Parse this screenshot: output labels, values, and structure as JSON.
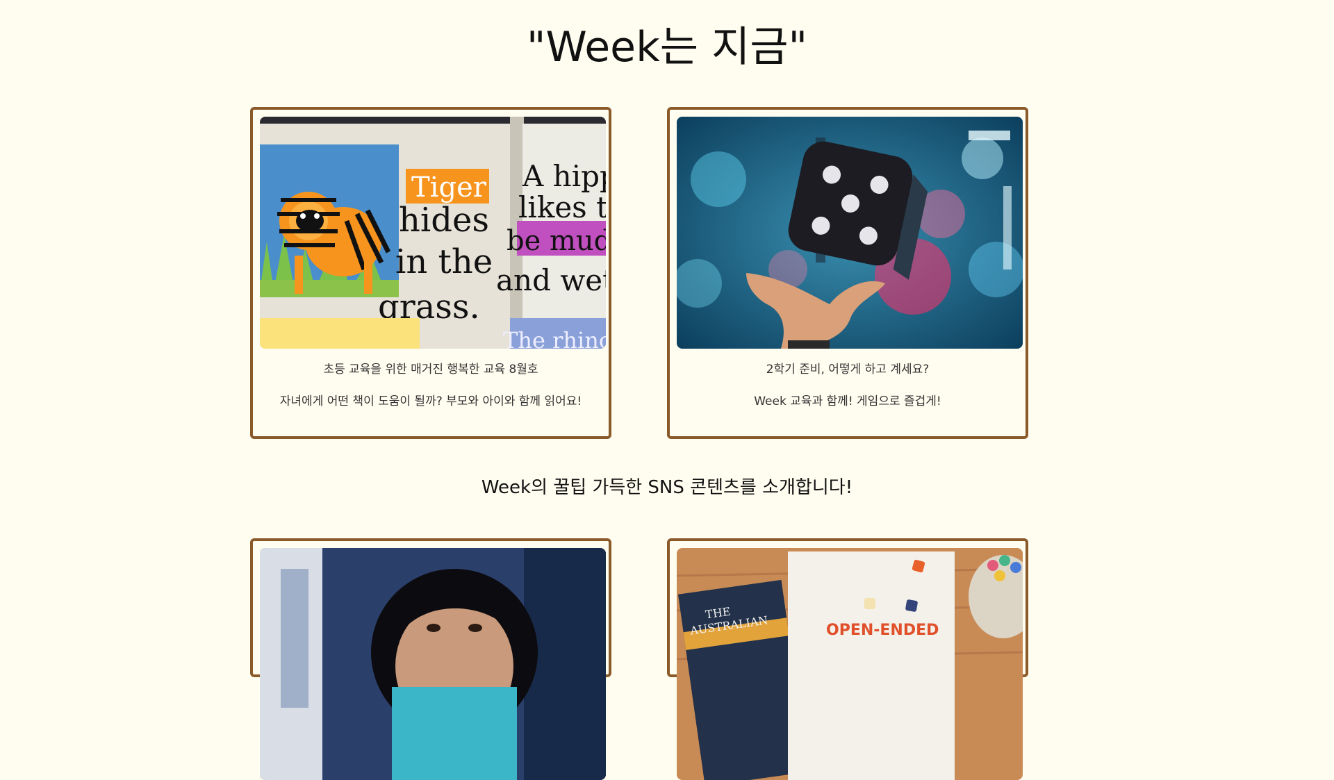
{
  "header": {
    "title": "\"Week는 지금\""
  },
  "cards_top": [
    {
      "image_alt": "tiger-newspaper-image",
      "line1": "초등 교육을 위한 매거진 행복한 교육 8월호",
      "line2": "자녀에게 어떤 책이 도움이 될까? 부모와 아이와 함께 읽어요!"
    },
    {
      "image_alt": "floating-dice-image",
      "line1": "2학기 준비, 어떻게 하고 계세요?",
      "line2": "Week 교육과 함께! 게임으로 즐겁게!"
    }
  ],
  "image_text": {
    "tiger_badge": "Tiger",
    "tiger_line1": "hides",
    "tiger_line2": "in the",
    "tiger_line3": "grass.",
    "right_line1": "A hipp",
    "right_line2": "likes to",
    "right_line3": "be muddy",
    "right_line4": "and wet.",
    "right_line5": "The rhino li",
    "book1_line1": "THE",
    "book1_line2": "AUSTRALIAN",
    "book2_title": "OPEN-ENDED"
  },
  "sns": {
    "subtitle": "Week의 꿀팁 가득한 SNS 콘텐츠를 소개합니다!"
  },
  "cards_bottom": [
    {
      "image_alt": "child-photo-image"
    },
    {
      "image_alt": "open-ended-books-image"
    }
  ],
  "colors": {
    "background": "#fffdf0",
    "card_border": "#8b5a2b"
  }
}
